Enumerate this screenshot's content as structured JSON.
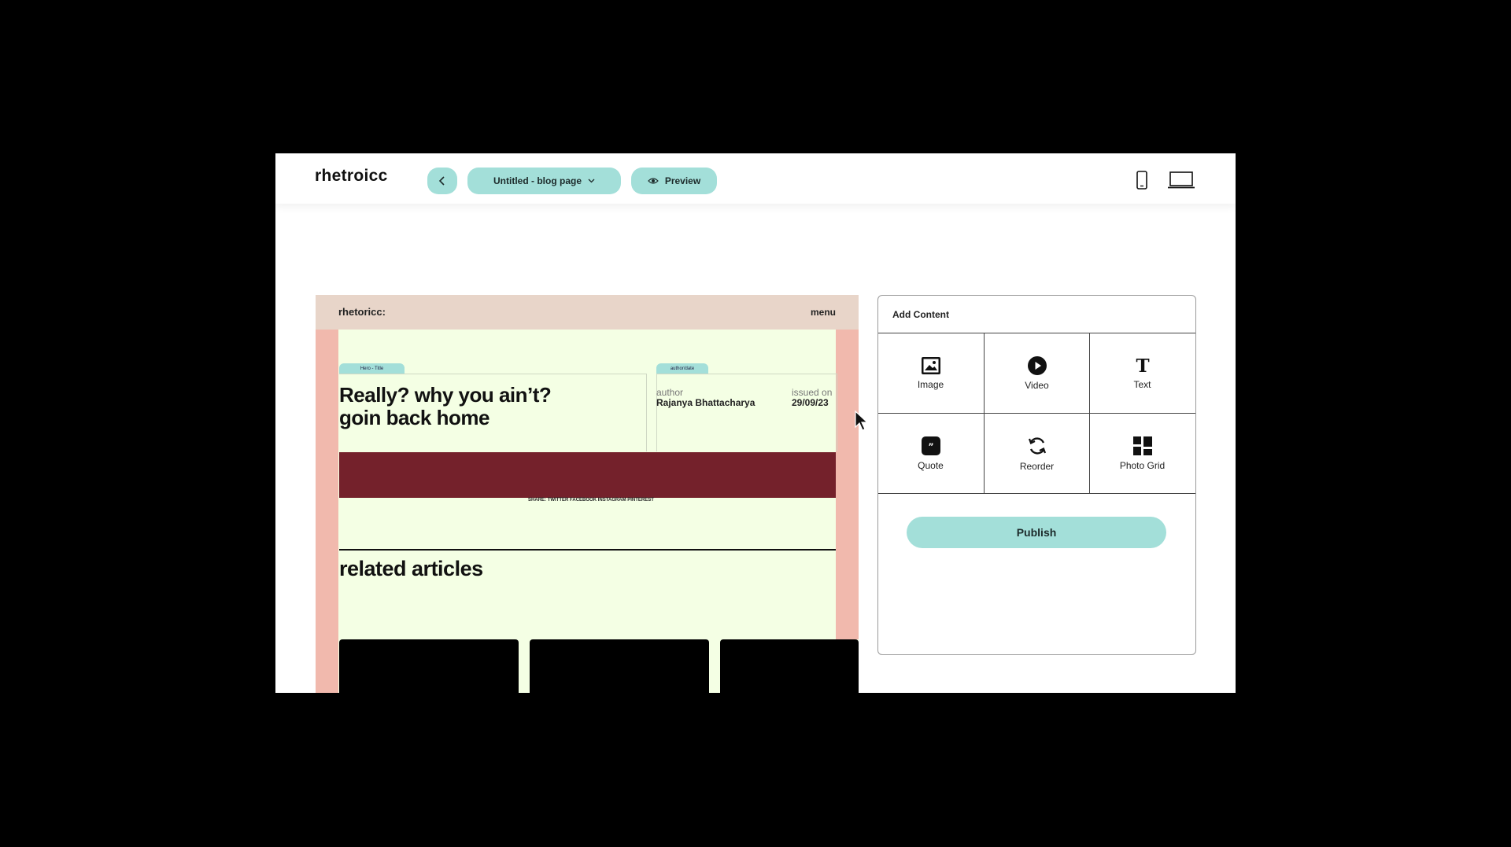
{
  "app": {
    "brand": "rhetroicc",
    "page_select_label": "Untitled - blog page",
    "preview_label": "Preview",
    "icons": {
      "back": "chevron-left-icon",
      "dropdown": "chevron-down-icon",
      "preview": "eye-icon",
      "mobile": "mobile-device-icon",
      "desktop": "laptop-device-icon"
    },
    "accent_color": "#a3dfd9"
  },
  "blog": {
    "logo": "rhetoricc:",
    "menu": "menu",
    "hero_tag": "Hero - Title",
    "author_tag": "author/date",
    "hero_title_line1": "Really? why you ain’t?",
    "hero_title_line2": "goin back home",
    "author_label": "author",
    "author_name": "Rajanya Bhattacharya",
    "issued_label": "issued on",
    "issued_date": "29/09/23",
    "share_text": "SHARE: TWITTER FACEBOOK INSTAGRAM PINTEREST",
    "related_heading": "related articles",
    "colors": {
      "background": "#f4ffe4",
      "gutter": "#f1b9ad",
      "banner": "#74212b"
    }
  },
  "panel": {
    "title": "Add Content",
    "items": [
      {
        "label": "Image",
        "icon": "image-icon"
      },
      {
        "label": "Video",
        "icon": "play-icon"
      },
      {
        "label": "Text",
        "icon": "text-icon"
      },
      {
        "label": "Quote",
        "icon": "quote-icon"
      },
      {
        "label": "Reorder",
        "icon": "reorder-icon"
      },
      {
        "label": "Photo Grid",
        "icon": "photo-grid-icon"
      }
    ],
    "publish_label": "Publish"
  }
}
